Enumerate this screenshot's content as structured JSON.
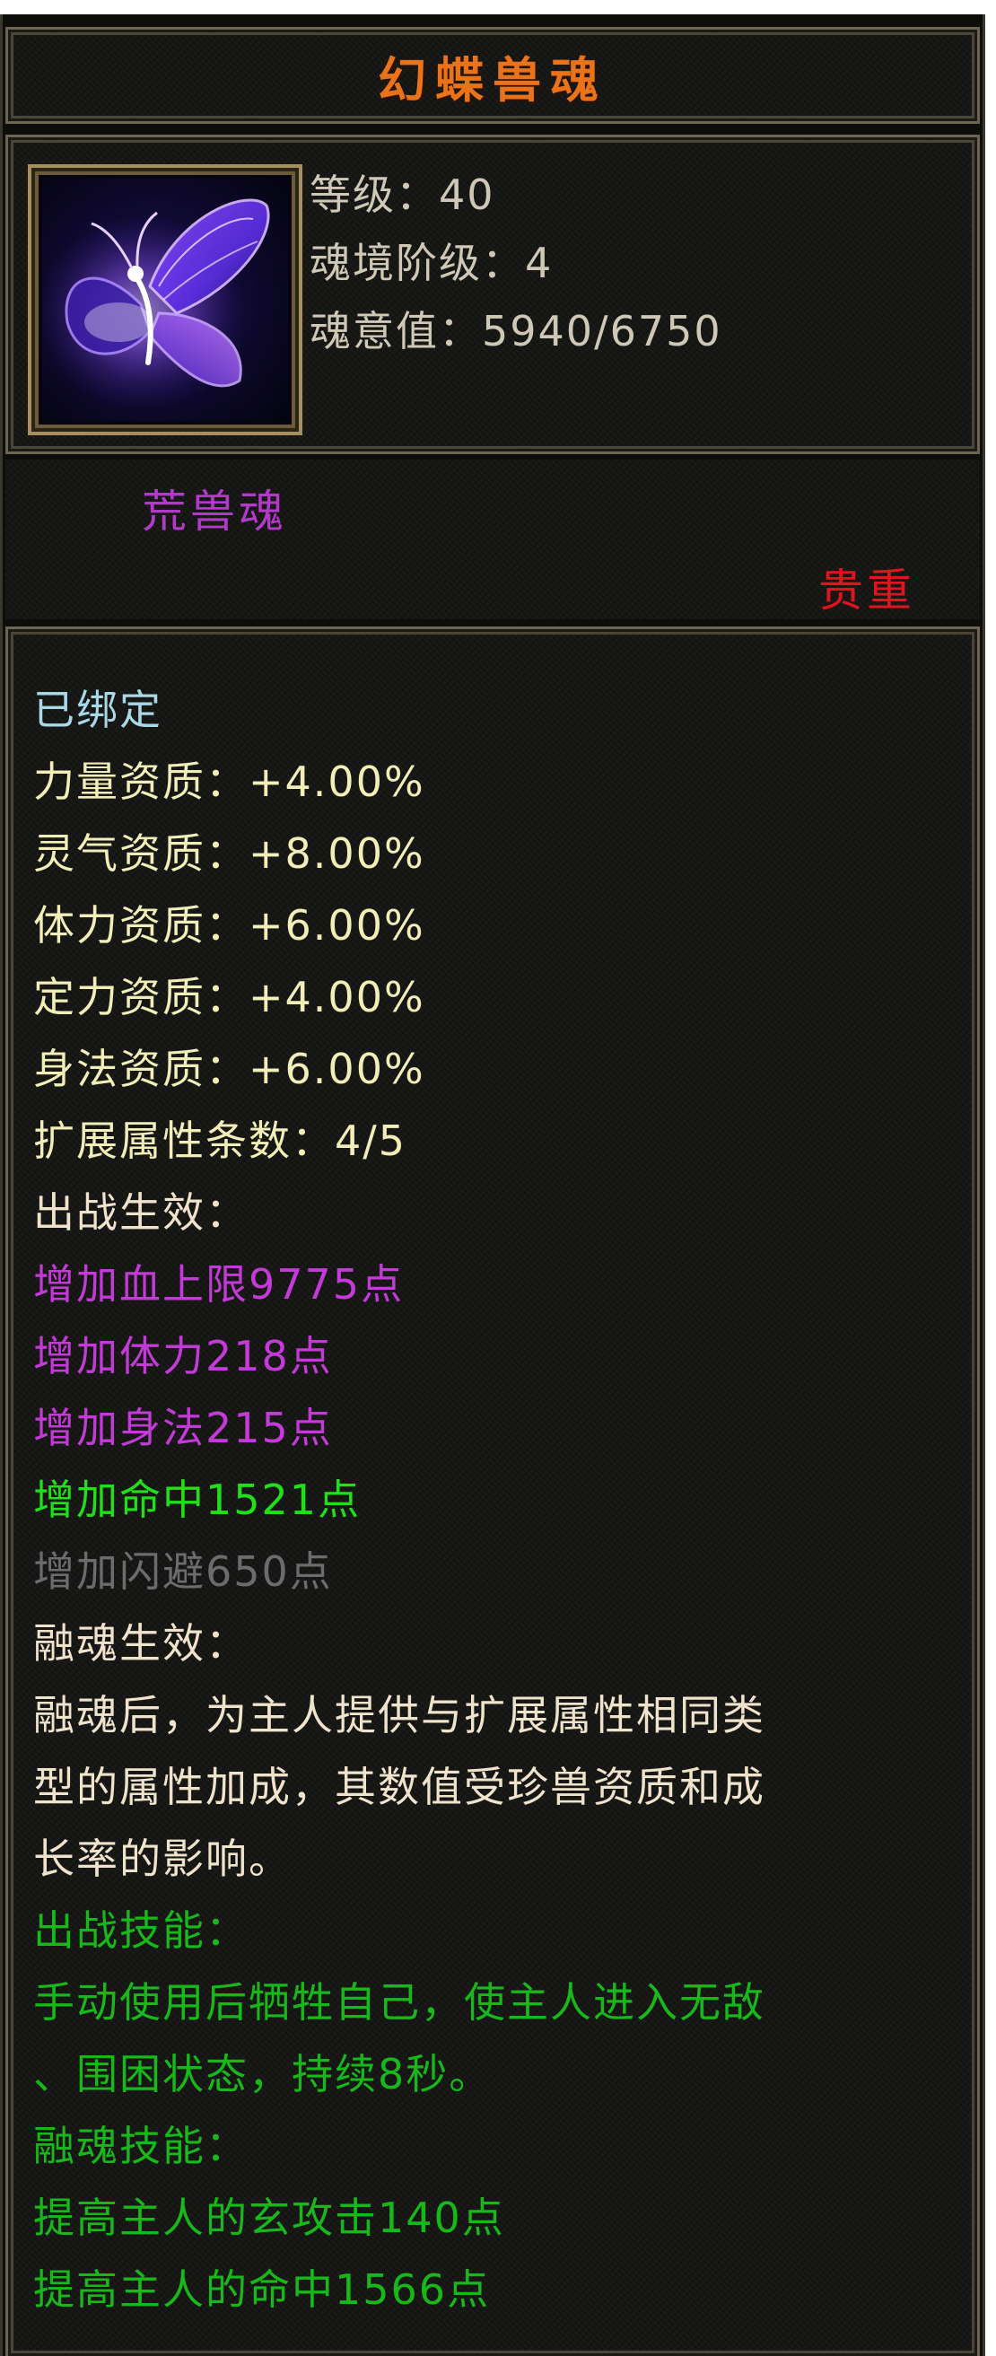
{
  "title": "幻蝶兽魂",
  "info": {
    "level": "等级：40",
    "realm_rank": "魂境阶级：4",
    "soul_value": "魂意值：5940/6750"
  },
  "category": "荒兽魂",
  "quality": "贵重",
  "icon": "purple-butterfly-icon",
  "colors": {
    "title": "#e8731b",
    "category": "#b23ac8",
    "quality": "#e0141c",
    "bound": "#a9d8e6",
    "stat": "#f1eeb8",
    "purple": "#c23bd6",
    "green": "#21e019",
    "gray": "#6c6c6c",
    "skill": "#18b81a"
  },
  "attributes": {
    "bound": "已绑定",
    "stats": [
      "力量资质：+4.00%",
      "灵气资质：+8.00%",
      "体力资质：+6.00%",
      "定力资质：+4.00%",
      "身法资质：+6.00%",
      "扩展属性条数：4/5"
    ],
    "battle_effect_heading": "出战生效：",
    "battle_effects": [
      "增加血上限9775点",
      "增加体力218点",
      "增加身法215点",
      "增加命中1521点",
      "增加闪避650点"
    ],
    "fusion_effect_heading": "融魂生效：",
    "fusion_effect_lines": [
      "融魂后，为主人提供与扩展属性相同类",
      "型的属性加成，其数值受珍兽资质和成",
      "长率的影响。"
    ],
    "battle_skill_heading": "出战技能：",
    "battle_skill_lines": [
      "手动使用后牺牲自己，使主人进入无敌",
      "、围困状态，持续8秒。"
    ],
    "fusion_skill_heading": "融魂技能：",
    "fusion_skills": [
      "提高主人的玄攻击140点",
      "提高主人的命中1566点"
    ]
  }
}
